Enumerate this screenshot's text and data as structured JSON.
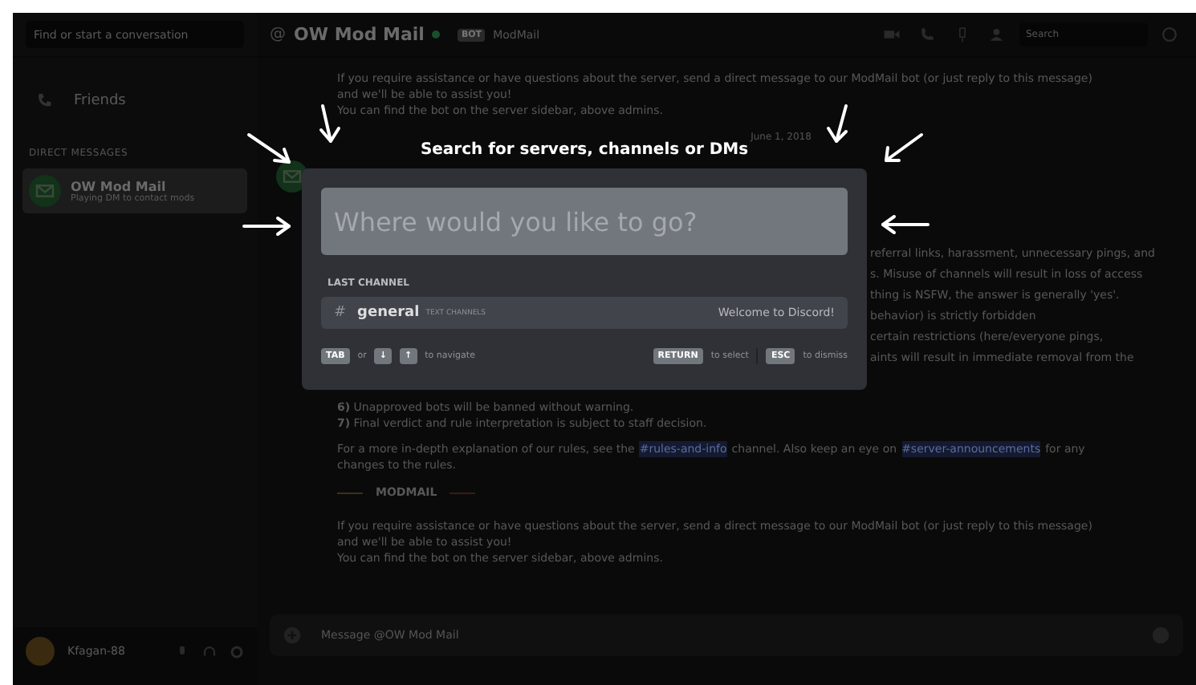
{
  "sidebar": {
    "search": {
      "placeholder": "Find or start a conversation"
    },
    "friends": {
      "label": "Friends"
    },
    "dm_heading": "DIRECT MESSAGES",
    "dms": [
      {
        "name": "OW Mod Mail",
        "status": "Playing DM to contact mods",
        "selected": true
      }
    ],
    "user": {
      "name": "Kfagan-88"
    }
  },
  "header": {
    "symbol": "@",
    "channel": "OW Mod Mail",
    "badge": "BOT",
    "subtitle": "ModMail",
    "search": {
      "placeholder": "Search"
    }
  },
  "chat": {
    "blocks": [
      {
        "kind": "paragraph",
        "lines": [
          "If you require assistance or have questions about the server, send a direct message to our ModMail bot (or just reply to this message)",
          "and we'll be able to assist you!",
          "You can find the bot on the server sidebar, above admins."
        ]
      },
      {
        "kind": "date",
        "text": "June 1, 2018"
      },
      {
        "kind": "author"
      },
      {
        "kind": "fragments",
        "lines": [
          "referral links, harassment, unnecessary pings, and",
          "s.  Misuse of channels will result in loss of access",
          "thing is NSFW, the answer is generally 'yes'.",
          "behavior) is strictly forbidden",
          "certain restrictions (here/everyone pings,",
          "aints will result in immediate removal from the"
        ]
      },
      {
        "kind": "rules",
        "lines": [
          "**6)** Unapproved bots will be banned without warning.",
          "**7)** Final verdict and rule interpretation is subject to staff decision."
        ]
      },
      {
        "kind": "links",
        "parts": [
          {
            "kind": "text",
            "text": "For a more in-depth explanation of our rules, see the"
          },
          {
            "kind": "link",
            "text": "#rules-and-info"
          },
          {
            "kind": "text",
            "text": "channel. Also keep an eye on"
          },
          {
            "kind": "link",
            "text": "#server-announcements"
          },
          {
            "kind": "text",
            "text": "for any"
          }
        ],
        "tail": "changes to the rules."
      },
      {
        "kind": "divider",
        "text": "MODMAIL"
      },
      {
        "kind": "paragraph",
        "lines": [
          "If you require assistance or have questions about the server, send a direct message to our ModMail bot (or just reply to this message)",
          "and we'll be able to assist you!",
          "You can find the bot on the server sidebar, above admins."
        ]
      }
    ],
    "composer": {
      "placeholder": "Message @OW Mod Mail"
    }
  },
  "switcher": {
    "title": "Search for servers, channels or DMs",
    "input": {
      "placeholder": "Where would you like to go?"
    },
    "section": "LAST CHANNEL",
    "results": [
      {
        "symbol": "#",
        "name": "general",
        "category": "TEXT CHANNELS",
        "hint": "Welcome to Discord!",
        "selected": true
      }
    ],
    "footer": [
      {
        "kind": "key",
        "text": "TAB"
      },
      {
        "kind": "text",
        "text": "or"
      },
      {
        "kind": "key",
        "text": "↓"
      },
      {
        "kind": "key",
        "text": "↑"
      },
      {
        "kind": "text",
        "text": "to navigate"
      },
      {
        "kind": "gap"
      },
      {
        "kind": "key",
        "text": "RETURN"
      },
      {
        "kind": "text",
        "text": "to select"
      },
      {
        "kind": "sep"
      },
      {
        "kind": "key",
        "text": "ESC"
      },
      {
        "kind": "text",
        "text": "to dismiss"
      }
    ]
  }
}
